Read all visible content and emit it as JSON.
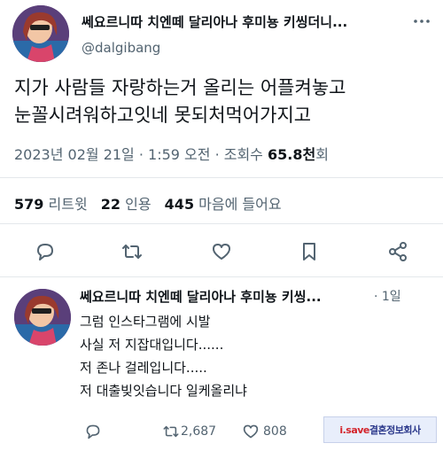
{
  "tweet": {
    "display_name": "쎄요르니따 치엔떼 달리아나 후미뇽 키씽더니...",
    "handle": "@dalgibang",
    "text_line1": "지가 사람들 자랑하는거 올리는 어플켜놓고",
    "text_line2": "눈꼴시려워하고잇네 못되처먹어가지고",
    "timestamp": "2023년 02월 21일 · 1:59 오전 · 조회수",
    "views_number": "65.8",
    "views_unit": "천",
    "views_suffix": "회",
    "stats": {
      "retweets_count": "579",
      "retweets_label": "리트윗",
      "quotes_count": "22",
      "quotes_label": "인용",
      "likes_count": "445",
      "likes_label": "마음에 들어요"
    }
  },
  "reply": {
    "display_name": "쎄요르니따 치엔떼 달리아나 후미뇽 키씽...",
    "time": "· 1일",
    "lines": [
      "그럼 인스타그램에 시발",
      "사실 저 지잡대입니다......",
      "저 존나 걸레입니다.....",
      "저 대출빚잇습니다 일케올리냐"
    ],
    "retweet_count": "2,687",
    "like_count": "808"
  },
  "watermark": {
    "prefix": "i.save",
    "rest": "결혼정보회사"
  },
  "colors": {
    "text": "#0f1419",
    "muted": "#536471",
    "divider": "#e4e8eb"
  },
  "icons": [
    "reply-icon",
    "retweet-icon",
    "like-icon",
    "bookmark-icon",
    "share-icon",
    "more-icon"
  ]
}
